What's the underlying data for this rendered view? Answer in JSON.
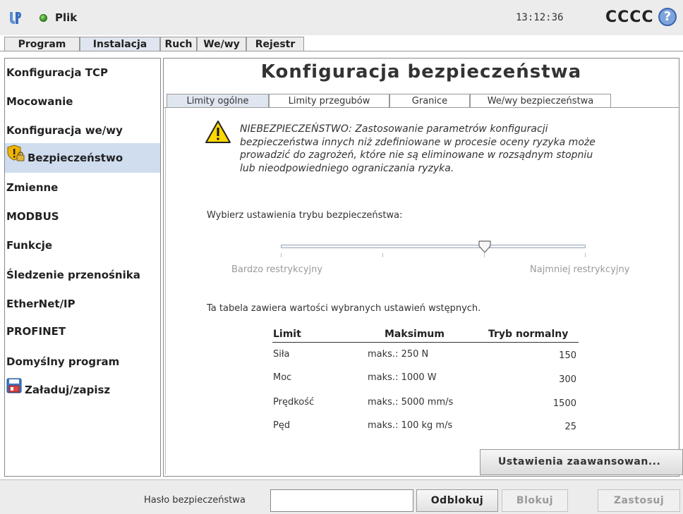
{
  "header": {
    "file_label": "Plik",
    "time": "13:12:36",
    "robot_name": "CCCC",
    "help_glyph": "?"
  },
  "main_tabs": [
    {
      "label": "Program"
    },
    {
      "label": "Instalacja",
      "active": true
    },
    {
      "label": "Ruch"
    },
    {
      "label": "We/wy"
    },
    {
      "label": "Rejestr"
    }
  ],
  "sidebar": {
    "items": [
      {
        "label": "Konfiguracja TCP"
      },
      {
        "label": "Mocowanie"
      },
      {
        "label": "Konfiguracja we/wy"
      },
      {
        "label": "Bezpieczeństwo",
        "active": true,
        "icon": "safety-shield-lock-icon"
      },
      {
        "label": "Zmienne"
      },
      {
        "label": "MODBUS"
      },
      {
        "label": "Funkcje"
      },
      {
        "label": "Śledzenie przenośnika"
      },
      {
        "label": "EtherNet/IP"
      },
      {
        "label": "PROFINET"
      },
      {
        "label": "Domyślny program"
      },
      {
        "label": "Załaduj/zapisz",
        "icon": "floppy-disk-icon"
      }
    ]
  },
  "page": {
    "title": "Konfiguracja bezpieczeństwa",
    "sub_tabs": [
      {
        "label": "Limity ogólne",
        "active": true
      },
      {
        "label": "Limity przegubów"
      },
      {
        "label": "Granice"
      },
      {
        "label": "We/wy bezpieczeństwa"
      }
    ],
    "warning": {
      "icon": "warning-triangle-icon",
      "lines": [
        "NIEBEZPIECZEŃSTWO: Zastosowanie parametrów konfiguracji",
        "bezpieczeństwa innych niż zdefiniowane w procesie oceny ryzyka może",
        "prowadzić do zagrożeń, które nie są eliminowane w rozsądnym stopniu",
        "lub nieodpowiedniego ograniczania ryzyka."
      ]
    },
    "mode_label": "Wybierz ustawienia trybu bezpieczeństwa:",
    "slider": {
      "min_label": "Bardzo restrykcyjny",
      "max_label": "Najmniej restrykcyjny",
      "value": 0.67
    },
    "table_description": "Ta tabela zawiera wartości wybranych ustawień wstępnych.",
    "table": {
      "headers": [
        "Limit",
        "Maksimum",
        "Tryb normalny"
      ],
      "rows": [
        [
          "Siła",
          "maks.: 250 N",
          "150"
        ],
        [
          "Moc",
          "maks.: 1000 W",
          "300"
        ],
        [
          "Prędkość",
          "maks.: 5000 mm/s",
          "1500"
        ],
        [
          "Pęd",
          "maks.: 100 kg m/s",
          "25"
        ]
      ]
    },
    "advanced_button": "Ustawienia zaawansowan..."
  },
  "footer": {
    "password_label": "Hasło bezpieczeństwa",
    "password_value": "",
    "unlock": "Odblokuj",
    "lock": "Blokuj",
    "apply": "Zastosuj"
  },
  "colors": {
    "active_tab": "#dfe6ef",
    "active_sidebar": "#cfddef",
    "status_green": "#2c8a1b",
    "help_blue": "#7da4db"
  }
}
